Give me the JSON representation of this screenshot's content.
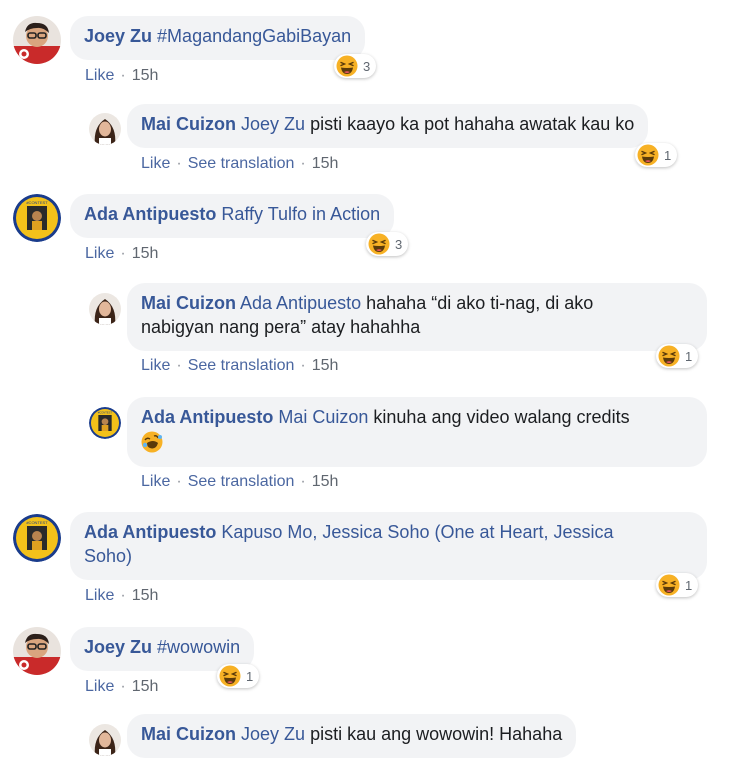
{
  "comments": [
    {
      "avatar": "joey-zu-avatar",
      "author": "Joey Zu",
      "tag": "",
      "text": "#MagandangGabiBayan",
      "like": "Like",
      "time": "15h",
      "reaction": "haha",
      "count": "3"
    },
    {
      "avatar": "mai-cuizon-avatar",
      "author": "Mai Cuizon",
      "tag": "Joey Zu",
      "text": "pisti kaayo ka pot hahaha awatak kau ko",
      "like": "Like",
      "translate": "See translation",
      "time": "15h",
      "reaction": "haha",
      "count": "1"
    },
    {
      "avatar": "ada-antipuesto-avatar",
      "author": "Ada Antipuesto",
      "tag": "Raffy Tulfo in Action",
      "text": "",
      "like": "Like",
      "time": "15h",
      "reaction": "haha",
      "count": "3"
    },
    {
      "avatar": "mai-cuizon-avatar",
      "author": "Mai Cuizon",
      "tag": "Ada Antipuesto",
      "text1": "hahaha “di ako ti-nag, di ako",
      "text2": "nabigyan nang pera” atay hahahha",
      "like": "Like",
      "translate": "See translation",
      "time": "15h",
      "reaction": "haha",
      "count": "1"
    },
    {
      "avatar": "ada-antipuesto-avatar",
      "author": "Ada Antipuesto",
      "tag": "Mai Cuizon",
      "text": "kinuha ang video walang credits",
      "like": "Like",
      "translate": "See translation",
      "time": "15h",
      "emoji": "rofl"
    },
    {
      "avatar": "ada-antipuesto-avatar",
      "author": "Ada Antipuesto",
      "tag1": "Kapuso Mo, Jessica Soho (One at Heart, Jessica",
      "tag2": "Soho)",
      "like": "Like",
      "time": "15h",
      "reaction": "haha",
      "count": "1"
    },
    {
      "avatar": "joey-zu-avatar",
      "author": "Joey Zu",
      "tag": "",
      "text": "#wowowin",
      "like": "Like",
      "time": "15h",
      "reaction": "haha",
      "count": "1"
    },
    {
      "avatar": "mai-cuizon-avatar",
      "author": "Mai Cuizon",
      "tag": "Joey Zu",
      "text": "pisti kau ang wowowin! Hahaha"
    }
  ],
  "colors": {
    "author": "#385898",
    "bubble": "#f2f3f5",
    "meta": "#606770",
    "link": "#4b67a1"
  }
}
